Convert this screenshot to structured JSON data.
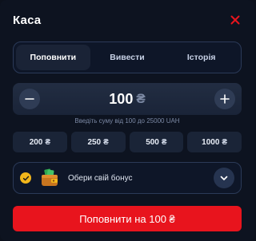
{
  "header": {
    "title": "Каса"
  },
  "tabs": [
    {
      "label": "Поповнити",
      "active": true
    },
    {
      "label": "Вивести",
      "active": false
    },
    {
      "label": "Історія",
      "active": false
    }
  ],
  "amount": {
    "value": "100",
    "currency": "₴"
  },
  "hint": "Введіть суму від 100 до 25000 UAH",
  "presets": [
    {
      "value": "200",
      "currency": "₴"
    },
    {
      "value": "250",
      "currency": "₴"
    },
    {
      "value": "500",
      "currency": "₴"
    },
    {
      "value": "1000",
      "currency": "₴"
    }
  ],
  "bonus": {
    "label": "Обери свій бонус"
  },
  "cta": {
    "label": "Поповнити на 100 ₴"
  },
  "colors": {
    "accent": "#e8141d",
    "check": "#f2b61b",
    "background": "#0d1320"
  },
  "icons": {
    "close": "close-icon",
    "minus": "minus-icon",
    "plus": "plus-icon",
    "check": "check-icon",
    "wallet": "wallet-icon",
    "chevron": "chevron-down-icon"
  }
}
